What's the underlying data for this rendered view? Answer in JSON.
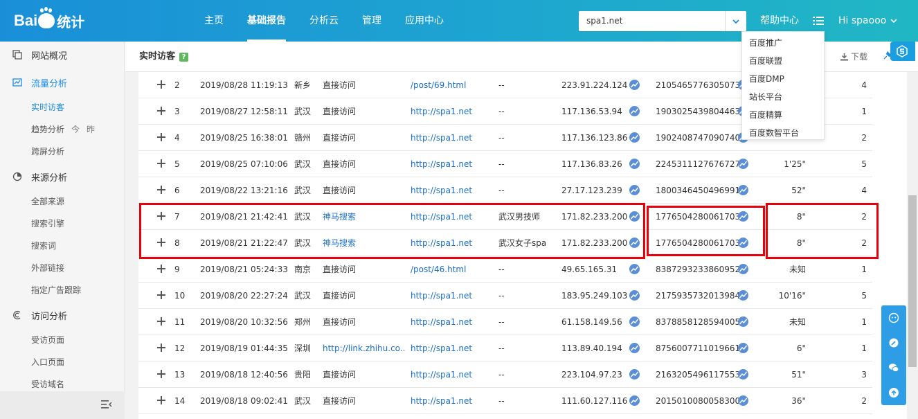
{
  "header": {
    "logo_text_1": "Bai",
    "logo_text_2": "统计",
    "nav": [
      "主页",
      "基础报告",
      "分析云",
      "管理",
      "应用中心"
    ],
    "active_nav": "基础报告",
    "site_value": "spa1.net",
    "help_label": "帮助中心",
    "greeting": "Hi spaooo"
  },
  "dropdown": {
    "items": [
      "百度推广",
      "百度联盟",
      "百度DMP",
      "站长平台",
      "百度精算",
      "百度数智平台"
    ]
  },
  "sidebar": {
    "groups": [
      {
        "label": "网站概况",
        "icon": "overview-icon"
      },
      {
        "label": "流量分析",
        "icon": "traffic-icon",
        "active": true
      },
      {
        "label": "来源分析",
        "icon": "source-icon"
      },
      {
        "label": "访问分析",
        "icon": "visit-icon"
      }
    ],
    "subs": [
      "实时访客",
      "趋势分析",
      "跨屏分析",
      "全部来源",
      "搜索引擎",
      "搜索词",
      "外部链接",
      "指定广告跟踪",
      "受访页面",
      "入口页面",
      "受访域名"
    ],
    "trend_today": "今",
    "trend_yesterday": "昨"
  },
  "main": {
    "title": "实时访客",
    "help_mark": "?",
    "download_label": "下载"
  },
  "colors": {
    "accent": "#1b8ce3",
    "link": "#1b6fc6",
    "highlight": "#e8000b"
  },
  "rows": [
    {
      "no": "2",
      "time": "2019/08/28 11:19:13",
      "city": "新乡",
      "source": "直接访问",
      "source_link": false,
      "entry": "/post/69.html",
      "keyword": "--",
      "ip": "223.91.224.124",
      "visitor": "2105465776305073...",
      "dur": "",
      "pages": "4"
    },
    {
      "no": "3",
      "time": "2019/08/27 12:58:11",
      "city": "武汉",
      "source": "直接访问",
      "source_link": false,
      "entry": "http://spa1.net",
      "keyword": "--",
      "ip": "117.136.53.94",
      "visitor": "1903025439804463...",
      "dur": "",
      "pages": "1"
    },
    {
      "no": "4",
      "time": "2019/08/25 16:38:01",
      "city": "赣州",
      "source": "直接访问",
      "source_link": false,
      "entry": "http://spa1.net",
      "keyword": "--",
      "ip": "117.136.123.86",
      "visitor": "1902408747090740...",
      "dur": "",
      "pages": "2"
    },
    {
      "no": "5",
      "time": "2019/08/25 07:10:06",
      "city": "武汉",
      "source": "直接访问",
      "source_link": false,
      "entry": "http://spa1.net",
      "keyword": "--",
      "ip": "117.136.83.26",
      "visitor": "2245311127676727...",
      "dur": "1'25\"",
      "pages": "5"
    },
    {
      "no": "6",
      "time": "2019/08/22 13:21:16",
      "city": "武汉",
      "source": "直接访问",
      "source_link": false,
      "entry": "http://spa1.net",
      "keyword": "--",
      "ip": "27.17.123.239",
      "visitor": "1800346450496991...",
      "dur": "52\"",
      "pages": "4"
    },
    {
      "no": "7",
      "time": "2019/08/21 21:42:41",
      "city": "武汉",
      "source": "神马搜索",
      "source_link": true,
      "entry": "http://spa1.net",
      "keyword": "武汉男技师",
      "ip": "171.82.233.200",
      "visitor": "1776504280061703...",
      "dur": "8\"",
      "pages": "2"
    },
    {
      "no": "8",
      "time": "2019/08/21 21:22:47",
      "city": "武汉",
      "source": "神马搜索",
      "source_link": true,
      "entry": "http://spa1.net",
      "keyword": "武汉女子spa",
      "ip": "171.82.233.200",
      "visitor": "1776504280061703...",
      "dur": "8\"",
      "pages": "2"
    },
    {
      "no": "9",
      "time": "2019/08/21 05:24:33",
      "city": "南京",
      "source": "直接访问",
      "source_link": false,
      "entry": "/post/46.html",
      "keyword": "--",
      "ip": "49.65.165.31",
      "visitor": "8387293233860952...",
      "dur": "未知",
      "pages": "1"
    },
    {
      "no": "10",
      "time": "2019/08/20 22:27:24",
      "city": "武汉",
      "source": "直接访问",
      "source_link": false,
      "entry": "http://spa1.net",
      "keyword": "--",
      "ip": "183.95.249.103",
      "visitor": "2175935732013984...",
      "dur": "10'16\"",
      "pages": "5"
    },
    {
      "no": "11",
      "time": "2019/08/20 10:32:56",
      "city": "郑州",
      "source": "直接访问",
      "source_link": false,
      "entry": "http://spa1.net",
      "keyword": "--",
      "ip": "61.158.149.56",
      "visitor": "8378858128594005...",
      "dur": "未知",
      "pages": "1"
    },
    {
      "no": "12",
      "time": "2019/08/19 01:44:35",
      "city": "深圳",
      "source": "http://link.zhihu.co...",
      "source_link": true,
      "entry": "http://spa1.net",
      "keyword": "--",
      "ip": "113.89.40.194",
      "visitor": "8756007711019661...",
      "dur": "6\"",
      "pages": "1"
    },
    {
      "no": "13",
      "time": "2019/08/18 12:40:56",
      "city": "贵阳",
      "source": "直接访问",
      "source_link": false,
      "entry": "http://spa1.net",
      "keyword": "--",
      "ip": "223.104.97.23",
      "visitor": "2163205496117553...",
      "dur": "51\"",
      "pages": "3"
    },
    {
      "no": "14",
      "time": "2019/08/18 09:02:41",
      "city": "武汉",
      "source": "直接访问",
      "source_link": false,
      "entry": "http://spa1.net",
      "keyword": "--",
      "ip": "111.60.127.116",
      "visitor": "2015010080058300...",
      "dur": "36\"",
      "pages": "2"
    }
  ]
}
